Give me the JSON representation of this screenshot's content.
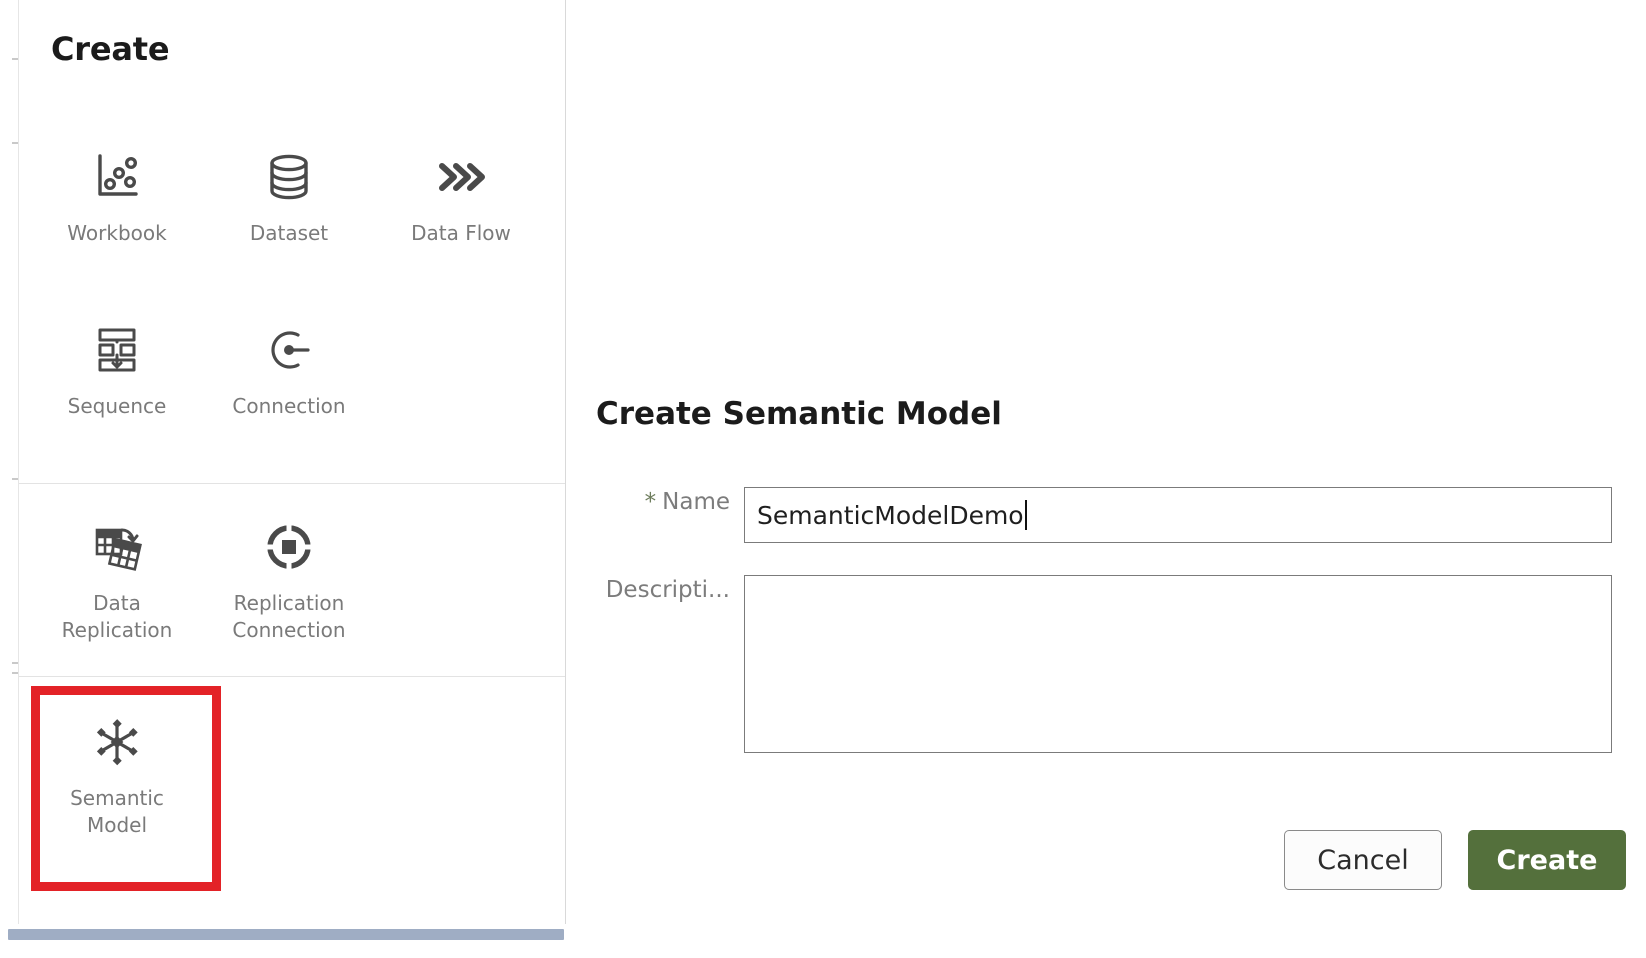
{
  "panel": {
    "title": "Create",
    "sections": [
      {
        "id": "primary",
        "rows": [
          [
            {
              "label": "Workbook",
              "icon": "workbook-chart-icon"
            },
            {
              "label": "Dataset",
              "icon": "dataset-database-icon"
            },
            {
              "label": "Data Flow",
              "icon": "data-flow-chevrons-icon"
            }
          ],
          [
            {
              "label": "Sequence",
              "icon": "sequence-steps-icon"
            },
            {
              "label": "Connection",
              "icon": "connection-plug-icon"
            }
          ]
        ]
      },
      {
        "id": "replication",
        "rows": [
          [
            {
              "label": "Data\nReplication",
              "icon": "data-replication-tables-icon"
            },
            {
              "label": "Replication\nConnection",
              "icon": "replication-connection-target-icon"
            }
          ]
        ]
      },
      {
        "id": "semantic",
        "rows": [
          [
            {
              "label": "Semantic\nModel",
              "icon": "semantic-model-snowflake-icon"
            }
          ]
        ]
      }
    ],
    "highlight_color": "#e32227",
    "scrollbar_color": "#9fadc4"
  },
  "dialog": {
    "title": "Create Semantic Model",
    "fields": {
      "name": {
        "label": "Name",
        "required_marker": "*",
        "value": "SemanticModelDemo",
        "placeholder": ""
      },
      "description": {
        "label": "Descripti...",
        "value": "",
        "placeholder": ""
      }
    },
    "buttons": {
      "cancel": "Cancel",
      "create": "Create"
    },
    "accent_color": "#54703c"
  }
}
